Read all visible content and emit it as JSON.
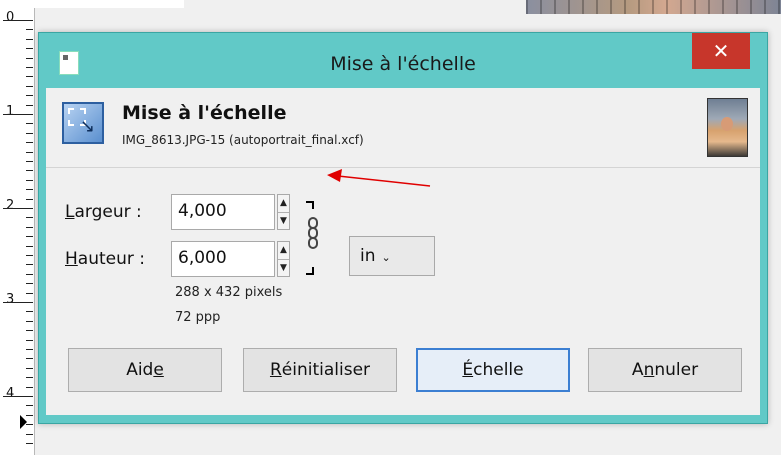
{
  "ruler": {
    "numbers": [
      "0",
      "1",
      "2",
      "3",
      "4"
    ]
  },
  "dialog": {
    "title": "Mise à l'échelle",
    "close_glyph": "✕",
    "header": {
      "title": "Mise à l'échelle",
      "subtitle": "IMG_8613.JPG-15 (autoportrait_final.xcf)"
    },
    "width": {
      "label_first": "L",
      "label_rest": "argeur :",
      "value": "4,000"
    },
    "height": {
      "label_first": "H",
      "label_rest": "auteur :",
      "value": "6,000"
    },
    "unit": {
      "value": "in",
      "arrow_glyph": "⌄"
    },
    "pixels_info": "288 x 432 pixels",
    "resolution_info": "72 ppp",
    "chain_linked": true,
    "buttons": {
      "help": {
        "before": "Aid",
        "mnemonic": "e",
        "after": ""
      },
      "reset": {
        "before": "",
        "mnemonic": "R",
        "after": "éinitialiser"
      },
      "scale": {
        "before": "",
        "mnemonic": "É",
        "after": "chelle"
      },
      "cancel": {
        "before": "A",
        "mnemonic": "n",
        "after": "nuler"
      }
    }
  },
  "colors": {
    "frame": "#61c9c7",
    "close": "#c7362b",
    "default_button_border": "#3c7fd2",
    "annotation_arrow": "#e00000"
  },
  "icons": {
    "app": "gimp-window-icon",
    "header": "scale-tool-icon",
    "thumbnail": "image-thumbnail",
    "chain": "chain-link-icon",
    "spin": "spin-arrows-icon"
  }
}
